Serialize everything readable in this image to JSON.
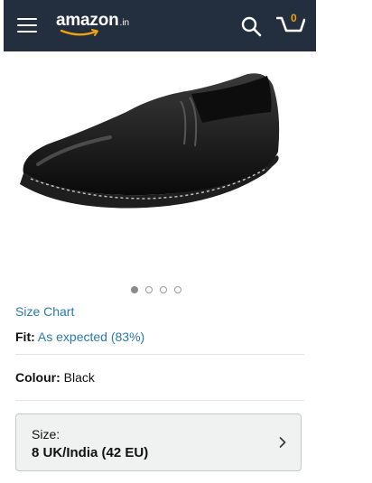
{
  "header": {
    "logo_word": "amazon",
    "logo_tld": ".in",
    "cart_count": "0",
    "colors": {
      "background": "#232f3e",
      "accent": "#f0a30a"
    }
  },
  "product": {
    "image_icon": "black-leather-slip-on-shoe",
    "carousel": {
      "total": 4,
      "active_index": 0
    }
  },
  "links": {
    "size_chart": "Size Chart"
  },
  "fit": {
    "label": "Fit:",
    "value": "As expected (83%)"
  },
  "colour": {
    "label": "Colour:",
    "value": "Black"
  },
  "size": {
    "label": "Size:",
    "value": "8 UK/India (42 EU)"
  },
  "colors": {
    "link": "#2a7ab3"
  }
}
